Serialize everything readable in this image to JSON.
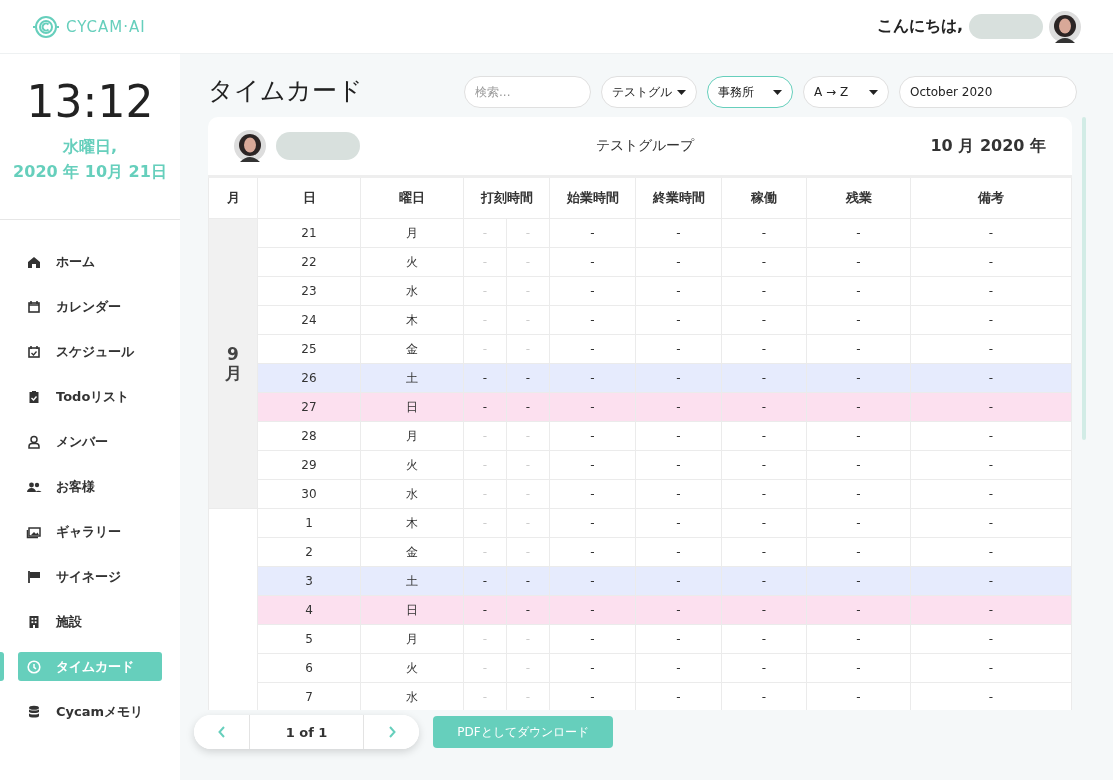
{
  "header": {
    "logo_text": "CYCAM·AI",
    "greeting": "こんにちは,"
  },
  "sidebar": {
    "clock": "13:12",
    "weekday": "水曜日,",
    "date": "2020 年 10月 21日",
    "items": [
      {
        "label": "ホーム",
        "kind": "home",
        "selected": false
      },
      {
        "label": "カレンダー",
        "kind": "calendar",
        "selected": false
      },
      {
        "label": "スケジュール",
        "kind": "schedule",
        "selected": false
      },
      {
        "label": "Todoリスト",
        "kind": "todo",
        "selected": false
      },
      {
        "label": "メンバー",
        "kind": "member",
        "selected": false
      },
      {
        "label": "お客様",
        "kind": "customers",
        "selected": false
      },
      {
        "label": "ギャラリー",
        "kind": "gallery",
        "selected": false
      },
      {
        "label": "サイネージ",
        "kind": "signage",
        "selected": false
      },
      {
        "label": "施設",
        "kind": "facility",
        "selected": false
      },
      {
        "label": "タイムカード",
        "kind": "timecard",
        "selected": true
      },
      {
        "label": "Cycamメモリ",
        "kind": "memory",
        "selected": false
      }
    ]
  },
  "page_title": "タイムカード",
  "filters": {
    "search": {
      "placeholder": "検索..."
    },
    "group": {
      "value": "テストグル"
    },
    "office": {
      "value": "事務所",
      "focused": true
    },
    "sort": {
      "value": "A → Z"
    },
    "month": {
      "value": "October 2020"
    }
  },
  "card": {
    "group": "テストグループ",
    "period": "10 月 2020 年"
  },
  "table": {
    "columns": [
      "月",
      "日",
      "曜日",
      "打刻時間",
      "始業時間",
      "終業時間",
      "稼働",
      "残業",
      "備考"
    ],
    "groups": [
      {
        "month": "9月",
        "rows": [
          {
            "day": "21",
            "weekday": "月",
            "kind": "weekday",
            "cells": [
              "-",
              "-",
              "-",
              "-",
              "-",
              "-",
              "-"
            ]
          },
          {
            "day": "22",
            "weekday": "火",
            "kind": "weekday",
            "cells": [
              "-",
              "-",
              "-",
              "-",
              "-",
              "-",
              "-"
            ]
          },
          {
            "day": "23",
            "weekday": "水",
            "kind": "weekday",
            "cells": [
              "-",
              "-",
              "-",
              "-",
              "-",
              "-",
              "-"
            ]
          },
          {
            "day": "24",
            "weekday": "木",
            "kind": "weekday",
            "cells": [
              "-",
              "-",
              "-",
              "-",
              "-",
              "-",
              "-"
            ]
          },
          {
            "day": "25",
            "weekday": "金",
            "kind": "weekday",
            "cells": [
              "-",
              "-",
              "-",
              "-",
              "-",
              "-",
              "-"
            ]
          },
          {
            "day": "26",
            "weekday": "土",
            "kind": "saturday",
            "cells": [
              "-",
              "-",
              "-",
              "-",
              "-",
              "-",
              "-"
            ]
          },
          {
            "day": "27",
            "weekday": "日",
            "kind": "sunday",
            "cells": [
              "-",
              "-",
              "-",
              "-",
              "-",
              "-",
              "-"
            ]
          },
          {
            "day": "28",
            "weekday": "月",
            "kind": "weekday",
            "cells": [
              "-",
              "-",
              "-",
              "-",
              "-",
              "-",
              "-"
            ]
          },
          {
            "day": "29",
            "weekday": "火",
            "kind": "weekday",
            "cells": [
              "-",
              "-",
              "-",
              "-",
              "-",
              "-",
              "-"
            ]
          },
          {
            "day": "30",
            "weekday": "水",
            "kind": "weekday",
            "cells": [
              "-",
              "-",
              "-",
              "-",
              "-",
              "-",
              "-"
            ]
          }
        ]
      },
      {
        "rows": [
          {
            "day": "1",
            "weekday": "木",
            "kind": "weekday",
            "cells": [
              "-",
              "-",
              "-",
              "-",
              "-",
              "-",
              "-"
            ]
          },
          {
            "day": "2",
            "weekday": "金",
            "kind": "weekday",
            "cells": [
              "-",
              "-",
              "-",
              "-",
              "-",
              "-",
              "-"
            ]
          },
          {
            "day": "3",
            "weekday": "土",
            "kind": "saturday",
            "cells": [
              "-",
              "-",
              "-",
              "-",
              "-",
              "-",
              "-"
            ]
          },
          {
            "day": "4",
            "weekday": "日",
            "kind": "sunday",
            "cells": [
              "-",
              "-",
              "-",
              "-",
              "-",
              "-",
              "-"
            ]
          },
          {
            "day": "5",
            "weekday": "月",
            "kind": "weekday",
            "cells": [
              "-",
              "-",
              "-",
              "-",
              "-",
              "-",
              "-"
            ]
          },
          {
            "day": "6",
            "weekday": "火",
            "kind": "weekday",
            "cells": [
              "-",
              "-",
              "-",
              "-",
              "-",
              "-",
              "-"
            ]
          },
          {
            "day": "7",
            "weekday": "水",
            "kind": "weekday",
            "cells": [
              "-",
              "-",
              "-",
              "-",
              "-",
              "-",
              "-"
            ]
          }
        ]
      }
    ]
  },
  "pagination": {
    "label": "1 of 1"
  },
  "download_button": "PDFとしてダウンロード"
}
